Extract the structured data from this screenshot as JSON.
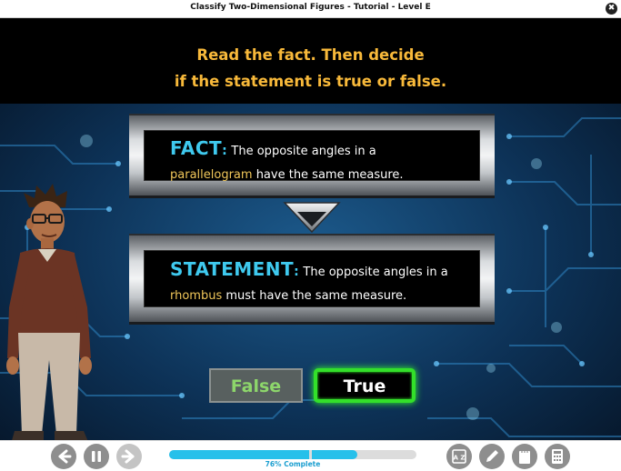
{
  "window": {
    "title": "Classify Two-Dimensional Figures - Tutorial - Level E",
    "close_glyph": "✖"
  },
  "instruction": {
    "line1": "Read the fact. Then decide",
    "line2": "if the statement is true or false."
  },
  "fact": {
    "tag": "FACT",
    "text_before": "The opposite angles in a",
    "highlight": "parallelogram",
    "text_after": "have the same measure."
  },
  "statement": {
    "tag": "STATEMENT",
    "text_before": "The opposite angles in a",
    "highlight": "rhombus",
    "text_after": "must have the same measure."
  },
  "answers": {
    "false_label": "False",
    "true_label": "True",
    "selected": "True"
  },
  "progress": {
    "percent": 76,
    "label": "76% Complete"
  },
  "controls": {
    "back_icon": "arrow-left-icon",
    "pause_icon": "pause-icon",
    "forward_icon": "arrow-right-icon",
    "glossary_label": "A Z",
    "tools": [
      "glossary-icon",
      "pencil-icon",
      "notes-icon",
      "calculator-icon"
    ]
  },
  "colors": {
    "instruction": "#f8b93a",
    "tag": "#3fc9ee",
    "highlight": "#f1c75a",
    "true_glow": "#33e02a",
    "progress": "#27c0ea"
  }
}
